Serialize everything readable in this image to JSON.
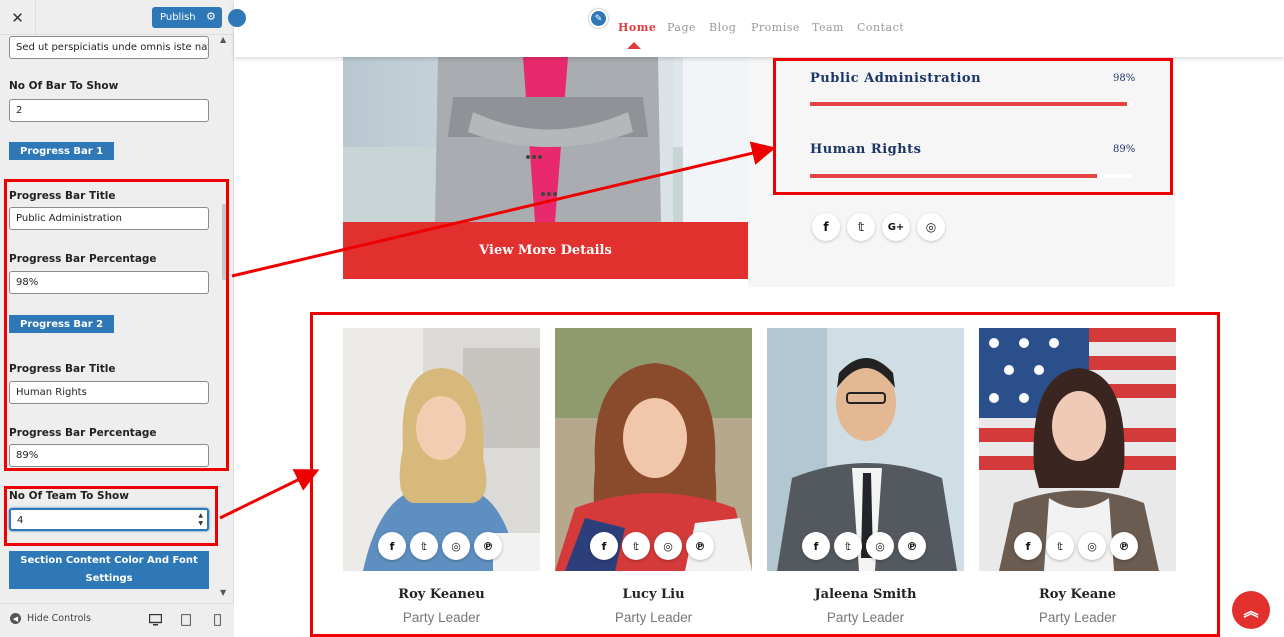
{
  "sidebar": {
    "close_label": "✕",
    "publish_label": "Publish",
    "top_field_value": "Sed ut perspiciatis unde omnis iste natu",
    "bar_count_label": "No Of Bar To Show",
    "bar_count_value": "2",
    "bars": [
      {
        "badge": "Progress Bar 1",
        "title_label": "Progress Bar Title",
        "title_value": "Public Administration",
        "pct_label": "Progress Bar Percentage",
        "pct_value": "98%"
      },
      {
        "badge": "Progress Bar 2",
        "title_label": "Progress Bar Title",
        "title_value": "Human Rights",
        "pct_label": "Progress Bar Percentage",
        "pct_value": "89%"
      }
    ],
    "team_count_label": "No Of Team To Show",
    "team_count_value": "4",
    "section_button_label": "Section Content Color And Font Settings",
    "hide_controls_label": "Hide Controls"
  },
  "nav": {
    "items": [
      "Home",
      "Page",
      "Blog",
      "Promise",
      "Team",
      "Contact"
    ],
    "active": "Home"
  },
  "hero": {
    "button_label": "View More Details"
  },
  "skills": [
    {
      "title": "Public Administration",
      "percent_label": "98%",
      "percent": 98
    },
    {
      "title": "Human Rights",
      "percent_label": "89%",
      "percent": 89
    }
  ],
  "social_icons": [
    "facebook-icon",
    "twitter-icon",
    "google-plus-icon",
    "instagram-icon"
  ],
  "social_glyphs": [
    "f",
    "𝕥",
    "G+",
    "◎"
  ],
  "team": [
    {
      "name": "Roy Keaneu",
      "role": "Party Leader"
    },
    {
      "name": "Lucy Liu",
      "role": "Party Leader"
    },
    {
      "name": "Jaleena Smith",
      "role": "Party Leader"
    },
    {
      "name": "Roy Keane",
      "role": "Party Leader"
    }
  ],
  "team_social_glyphs": [
    "f",
    "𝕥",
    "◎",
    "℗"
  ],
  "colors": {
    "accent_red": "#e1302d",
    "customizer_blue": "#2e78b8",
    "heading_navy": "#1c3668",
    "annotation_red": "#ee0000"
  }
}
